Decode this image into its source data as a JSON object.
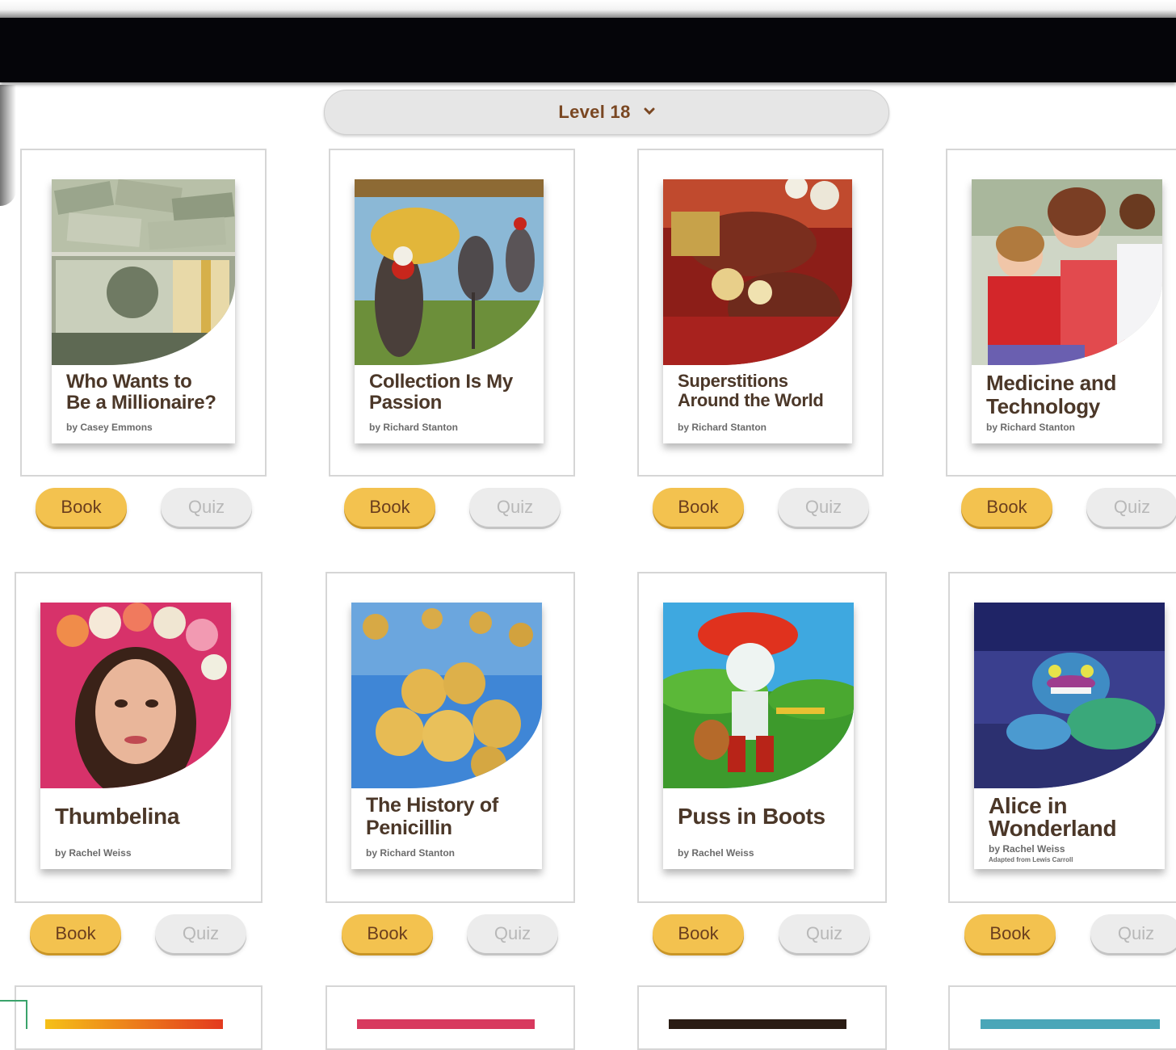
{
  "level_selector": {
    "label": "Level 18"
  },
  "books": [
    {
      "title_line1": "Who Wants to",
      "title_line2": "Be a Millionaire?",
      "author": "by Casey Emmons",
      "book_label": "Book",
      "quiz_label": "Quiz"
    },
    {
      "title_line1": "Collection Is My",
      "title_line2": "Passion",
      "author": "by Richard Stanton",
      "book_label": "Book",
      "quiz_label": "Quiz"
    },
    {
      "title_line1": "Superstitions",
      "title_line2": "Around the World",
      "author": "by Richard Stanton",
      "book_label": "Book",
      "quiz_label": "Quiz"
    },
    {
      "title_line1": "Medicine and",
      "title_line2": "Technology",
      "author": "by Richard Stanton",
      "book_label": "Book",
      "quiz_label": "Quiz"
    },
    {
      "title_line1": "Thumbelina",
      "title_line2": "",
      "author": "by Rachel Weiss",
      "book_label": "Book",
      "quiz_label": "Quiz"
    },
    {
      "title_line1": "The History of",
      "title_line2": "Penicillin",
      "author": "by Richard Stanton",
      "book_label": "Book",
      "quiz_label": "Quiz"
    },
    {
      "title_line1": "Puss in Boots",
      "title_line2": "",
      "author": "by Rachel Weiss",
      "book_label": "Book",
      "quiz_label": "Quiz"
    },
    {
      "title_line1": "Alice in",
      "title_line2": "Wonderland",
      "author": "by Rachel Weiss",
      "note": "Adapted from Lewis Carroll",
      "book_label": "Book",
      "quiz_label": "Quiz"
    }
  ],
  "colors": {
    "book_button": "#f3c24f",
    "quiz_button": "#ececec",
    "header": "#050509",
    "title_text": "#4b3728"
  }
}
